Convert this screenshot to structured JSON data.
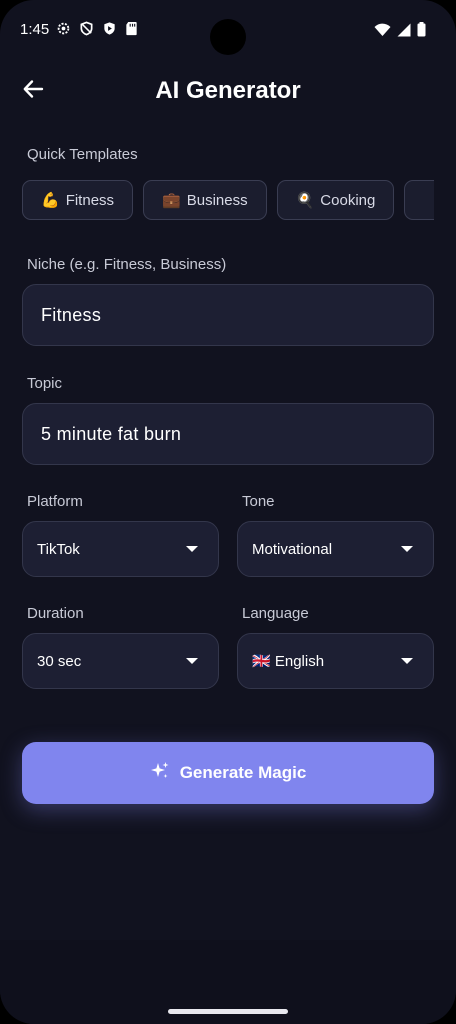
{
  "status": {
    "time": "1:45",
    "left_icons": [
      "settings-icon",
      "shield-icon",
      "play-protect-icon",
      "sd-card-icon"
    ],
    "right_icons": [
      "wifi-icon",
      "signal-icon",
      "battery-icon"
    ]
  },
  "header": {
    "title": "AI Generator",
    "back_icon": "arrow-left-icon"
  },
  "templates": {
    "label": "Quick Templates",
    "items": [
      {
        "emoji": "💪",
        "label": "Fitness"
      },
      {
        "emoji": "💼",
        "label": "Business"
      },
      {
        "emoji": "🍳",
        "label": "Cooking"
      },
      {
        "emoji": "",
        "label": ""
      }
    ]
  },
  "niche": {
    "label": "Niche (e.g. Fitness, Business)",
    "value": "Fitness"
  },
  "topic": {
    "label": "Topic",
    "value": "5 minute fat burn"
  },
  "platform": {
    "label": "Platform",
    "value": "TikTok"
  },
  "tone": {
    "label": "Tone",
    "value": "Motivational"
  },
  "duration": {
    "label": "Duration",
    "value": "30 sec"
  },
  "language": {
    "label": "Language",
    "value": "🇬🇧 English"
  },
  "generate": {
    "label": "Generate Magic",
    "icon": "sparkles-icon"
  },
  "colors": {
    "background": "#11121f",
    "field": "#1d1f33",
    "accent": "#8085ee"
  }
}
